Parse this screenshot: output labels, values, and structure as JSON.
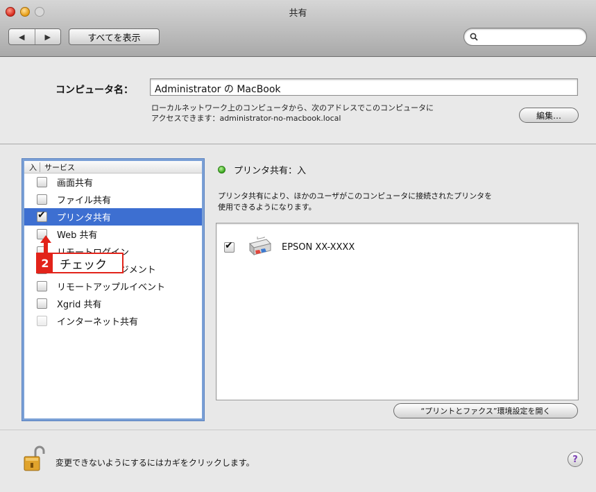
{
  "window": {
    "title": "共有"
  },
  "toolbar": {
    "back_icon": "◀",
    "forward_icon": "▶",
    "show_all_label": "すべてを表示",
    "search_value": ""
  },
  "computer": {
    "name_label": "コンピュータ名：",
    "name_value": "Administrator の MacBook",
    "desc_line1": "ローカルネットワーク上のコンピュータから、次のアドレスでこのコンピュータに",
    "desc_line2": "アクセスできます：administrator-no-macbook.local",
    "edit_label": "編集…"
  },
  "services": {
    "header_on": "入",
    "header_service": "サービス",
    "items": [
      {
        "label": "画面共有",
        "checked": false
      },
      {
        "label": "ファイル共有",
        "checked": false
      },
      {
        "label": "プリンタ共有",
        "checked": true,
        "selected": true
      },
      {
        "label": "Web 共有",
        "checked": false
      },
      {
        "label": "リモートログイン",
        "checked": false
      },
      {
        "label": "リモートマネージメント",
        "checked": false
      },
      {
        "label": "リモートアップルイベント",
        "checked": false
      },
      {
        "label": "Xgrid 共有",
        "checked": false
      },
      {
        "label": "インターネット共有",
        "checked": false,
        "disabled": true
      }
    ]
  },
  "annotation": {
    "number": "2",
    "text": "チェック",
    "color": "#e2231a"
  },
  "detail": {
    "status": "プリンタ共有：入",
    "status_color": "#35a41a",
    "desc_line1": "プリンタ共有により、ほかのユーザがこのコンピュータに接続されたプリンタを",
    "desc_line2": "使用できるようになります。",
    "printer_name": "EPSON XX-XXXX",
    "printer_checked": true,
    "open_prefs_label": "“プリントとファクス”環境設定を開く"
  },
  "footer": {
    "lock_text": "変更できないようにするにはカギをクリックします。",
    "help_label": "?"
  },
  "colors": {
    "selection": "#3d6fd1",
    "list_focus": "#7aa0d6"
  }
}
